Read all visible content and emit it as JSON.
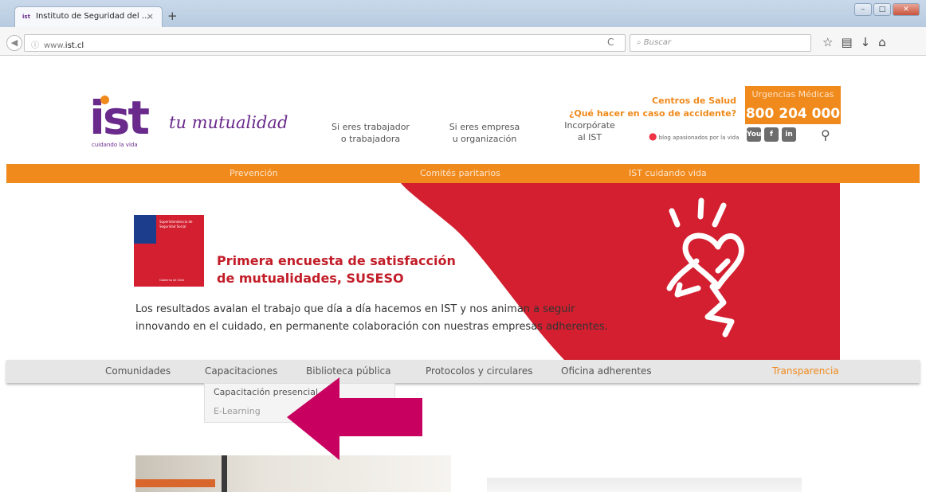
{
  "browser": {
    "tab_title": "Instituto de Seguridad del ...",
    "tab_favicon": "ist",
    "tab_close": "×",
    "new_tab": "+",
    "url_host_prefix": "www.",
    "url_host": "ist.cl",
    "search_placeholder": "Buscar",
    "window_buttons": [
      "–",
      "□",
      "✕"
    ]
  },
  "site": {
    "logo_text": "ist",
    "logo_tagline": "cuidando la vida",
    "logo_slogan": "tu mutualidad",
    "header_links": [
      {
        "line1": "Si eres trabajador",
        "line2": "o trabajadora"
      },
      {
        "line1": "Si eres empresa",
        "line2": "u organización"
      },
      {
        "line1": "Incorpórate",
        "line2": "al IST"
      }
    ],
    "centros_salud": "Centros de Salud",
    "que_hacer": "¿Qué hacer en caso de accidente?",
    "urgencias_label": "Urgencias Médicas",
    "urgencias_phone": "800 204 000",
    "blog_label": "blog",
    "blog_tagline": "apasionados por la vida",
    "social": [
      "You",
      "f",
      "in"
    ]
  },
  "main_nav": [
    "Prevención",
    "Comités paritarios",
    "IST cuidando vida"
  ],
  "banner": {
    "badge_text": "Superintendencia de Seguridad Social",
    "badge_footer": "Gobierno de Chile",
    "headline_line1": "Primera encuesta de satisfacción",
    "headline_line2": "de mutualidades, SUSESO",
    "body_line1": "Los resultados avalan el trabajo que día a día hacemos en IST y nos animan a seguir",
    "body_line2": "innovando en el cuidado, en permanente colaboración con nuestras empresas adherentes."
  },
  "sub_nav": [
    "Comunidades",
    "Capacitaciones",
    "Biblioteca pública",
    "Protocolos y circulares",
    "Oficina adherentes",
    "Transparencia"
  ],
  "dropdown": [
    "Capacitación presencial",
    "E-Learning"
  ],
  "colors": {
    "brand_purple": "#6a2a8c",
    "brand_orange": "#f08a1c",
    "banner_red": "#d31f2f",
    "arrow_magenta": "#c8005f"
  }
}
